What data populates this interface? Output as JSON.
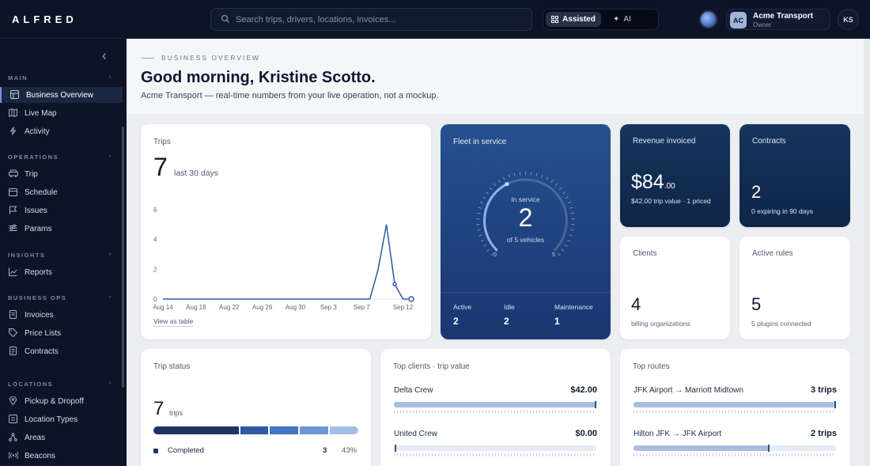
{
  "app": {
    "logo": "ALFRED",
    "search_placeholder": "Search trips, drivers, locations, invoices...",
    "modes": [
      "Assisted",
      "AI"
    ],
    "account": {
      "initials": "AC",
      "name": "Acme Transport",
      "role": "Owner"
    },
    "user_initials": "KS"
  },
  "sidebar": {
    "sections": [
      {
        "label": "MAIN",
        "items": [
          "Business Overview",
          "Live Map",
          "Activity"
        ]
      },
      {
        "label": "OPERATIONS",
        "items": [
          "Trip",
          "Schedule",
          "Issues",
          "Params"
        ]
      },
      {
        "label": "INSIGHTS",
        "items": [
          "Reports"
        ]
      },
      {
        "label": "BUSINESS OPS",
        "items": [
          "Invoices",
          "Price Lists",
          "Contracts"
        ]
      },
      {
        "label": "LOCATIONS",
        "items": [
          "Pickup & Dropoff",
          "Location Types",
          "Areas",
          "Beacons"
        ]
      }
    ],
    "active": "Business Overview"
  },
  "hero": {
    "eyebrow": "BUSINESS OVERVIEW",
    "greeting": "Good morning, Kristine Scotto.",
    "subtitle": "Acme Transport — real-time numbers from your live operation, not a mockup."
  },
  "trips_card": {
    "title": "Trips",
    "count": "7",
    "period": "last 30 days",
    "link": "View as table"
  },
  "chart_data": {
    "type": "line",
    "title": "",
    "xlabel": "",
    "ylabel": "",
    "ylim": [
      0,
      6
    ],
    "y_ticks": [
      "0",
      "2",
      "4",
      "6"
    ],
    "x_tick_labels": [
      "Aug 14",
      "Aug 18",
      "Aug 22",
      "Aug 26",
      "Aug 30",
      "Sep 3",
      "Sep 7",
      "Sep 12"
    ],
    "x": [
      "Aug 14",
      "Aug 15",
      "Aug 16",
      "Aug 17",
      "Aug 18",
      "Aug 19",
      "Aug 20",
      "Aug 21",
      "Aug 22",
      "Aug 23",
      "Aug 24",
      "Aug 25",
      "Aug 26",
      "Aug 27",
      "Aug 28",
      "Aug 29",
      "Aug 30",
      "Aug 31",
      "Sep 1",
      "Sep 2",
      "Sep 3",
      "Sep 4",
      "Sep 5",
      "Sep 6",
      "Sep 7",
      "Sep 8",
      "Sep 9",
      "Sep 10",
      "Sep 11",
      "Sep 12",
      "Sep 13"
    ],
    "series": [
      {
        "values": [
          0,
          0,
          0,
          0,
          0,
          0,
          0,
          0,
          0,
          0,
          0,
          0,
          0,
          0,
          0,
          0,
          0,
          0,
          0,
          0,
          0,
          0,
          0,
          0,
          0,
          0,
          2,
          5,
          1,
          0,
          0
        ]
      }
    ],
    "grid": false
  },
  "fleet": {
    "title": "Fleet in service",
    "gauge_label": "In service",
    "value": "2",
    "of_label": "of 5 vehicles",
    "min": "0",
    "max": "5",
    "fraction": 0.4,
    "stats": [
      {
        "label": "Active",
        "value": "2"
      },
      {
        "label": "Idle",
        "value": "2"
      },
      {
        "label": "Maintenance",
        "value": "1"
      }
    ]
  },
  "revenue": {
    "title": "Revenue invoiced",
    "amount": "$84",
    "cents": ".00",
    "note": "$42.00 trip value · 1 priced"
  },
  "contracts": {
    "title": "Contracts",
    "value": "2",
    "note": "0 expiring in 90 days"
  },
  "clients": {
    "title": "Clients",
    "value": "4",
    "note": "billing organizations"
  },
  "rules": {
    "title": "Active rules",
    "value": "5",
    "note": "5 plugins connected"
  },
  "trip_status": {
    "title": "Trip status",
    "total": "7",
    "unit": "trips",
    "segments": [
      {
        "value": 3,
        "color": "#1c3564"
      },
      {
        "value": 1,
        "color": "#2f5aa6"
      },
      {
        "value": 1,
        "color": "#4574c2"
      },
      {
        "value": 1,
        "color": "#6f95da"
      },
      {
        "value": 1,
        "color": "#a3bee8"
      }
    ],
    "rows": [
      {
        "label": "Completed",
        "count": "3",
        "pct": "43%"
      }
    ]
  },
  "top_clients": {
    "title": "Top clients · trip value",
    "rows": [
      {
        "name": "Delta Crew",
        "value": "$42.00",
        "fraction": 1.0
      },
      {
        "name": "United Crew",
        "value": "$0.00",
        "fraction": 0.0
      }
    ]
  },
  "top_routes": {
    "title": "Top routes",
    "rows": [
      {
        "name": "JFK Airport → Marriott Midtown",
        "value": "3 trips",
        "fraction": 1.0
      },
      {
        "name": "Hilton JFK → JFK Airport",
        "value": "2 trips",
        "fraction": 0.67
      }
    ]
  },
  "colors": {
    "accent": "#2a4f94",
    "sidebar_bg": "#0c1426",
    "line": "#2f5aa6"
  }
}
